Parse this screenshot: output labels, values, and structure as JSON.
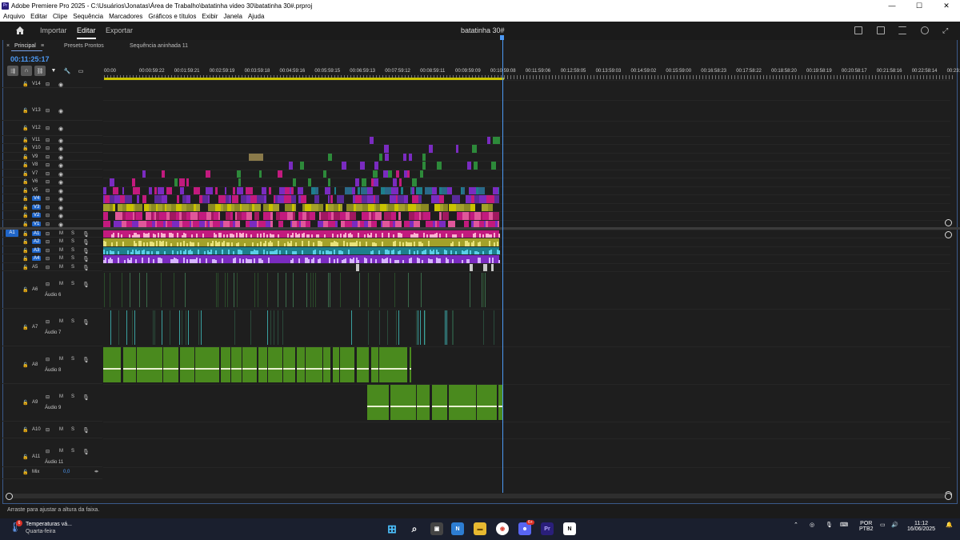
{
  "window": {
    "title": "Adobe Premiere Pro 2025 - C:\\Usuários\\Jonatas\\Área de Trabalho\\batatinha video 30\\batatinha 30#.prproj",
    "app_badge": "Pr",
    "minimize": "—",
    "maximize": "☐",
    "close": "✕"
  },
  "menu": [
    "Arquivo",
    "Editar",
    "Clipe",
    "Sequência",
    "Marcadores",
    "Gráficos e títulos",
    "Exibir",
    "Janela",
    "Ajuda"
  ],
  "nav": {
    "tabs": [
      "Importar",
      "Editar",
      "Exportar"
    ],
    "active": "Editar",
    "project_title": "batatinha 30#"
  },
  "panel": {
    "tabs": [
      "Principal",
      "Presets Prontos",
      "Sequência aninhada 11"
    ],
    "active": "Principal",
    "close": "×",
    "menu_icon": "≡",
    "timecode": "00:11:25:17"
  },
  "ruler": [
    "00:00",
    "00:00:59:22",
    "00:01:59:21",
    "00:02:59:19",
    "00:03:59:18",
    "00:04:59:16",
    "00:05:59:15",
    "00:06:59:13",
    "00:07:59:12",
    "00:08:59:11",
    "00:09:59:09",
    "00:10:59:08",
    "00:11:59:06",
    "00:12:59:05",
    "00:13:59:03",
    "00:14:59:02",
    "00:15:59:00",
    "00:16:58:23",
    "00:17:58:22",
    "00:18:58:20",
    "00:19:58:19",
    "00:20:58:17",
    "00:21:58:16",
    "00:22:58:14",
    "00:23:5"
  ],
  "video_tracks": [
    {
      "name": "V14",
      "tall": false
    },
    {
      "name": "V13",
      "tall": true
    },
    {
      "name": "V12",
      "tall": true
    },
    {
      "name": "V11"
    },
    {
      "name": "V10"
    },
    {
      "name": "V9"
    },
    {
      "name": "V8"
    },
    {
      "name": "V7"
    },
    {
      "name": "V6"
    },
    {
      "name": "V5"
    },
    {
      "name": "V4",
      "on": true
    },
    {
      "name": "V3",
      "on": true
    },
    {
      "name": "V2",
      "on": true
    },
    {
      "name": "V1",
      "on": true
    }
  ],
  "audio_tracks": [
    {
      "name": "A1",
      "on": true,
      "source": "A1"
    },
    {
      "name": "A2",
      "on": true
    },
    {
      "name": "A3",
      "on": true
    },
    {
      "name": "A4",
      "on": true
    },
    {
      "name": "A5"
    },
    {
      "name": "A6",
      "label": "Áudio 6"
    },
    {
      "name": "A7",
      "label": "Áudio 7"
    },
    {
      "name": "A8",
      "label": "Áudio 8"
    },
    {
      "name": "A9",
      "label": "Áudio 9"
    },
    {
      "name": "A10"
    },
    {
      "name": "A11",
      "label": "Áudio 11"
    }
  ],
  "mix": {
    "label": "Mix",
    "value": "0,0"
  },
  "mute_label": "M",
  "solo_label": "S",
  "status": "Arraste para ajustar a altura da faixa.",
  "taskbar": {
    "weather_title": "Temperaturas vá...",
    "weather_day": "Quarta-feira",
    "weather_badge": "6",
    "lang1": "POR",
    "lang2": "PTB2",
    "time": "11:12",
    "date": "16/06/2025",
    "discord_badge": "6+"
  },
  "colors": {
    "accent": "#4d9af5",
    "pink": "#e0579a",
    "magenta": "#c21a7e",
    "olive": "#a3a12a",
    "teal": "#1d7f8c",
    "purple": "#7a2bc0",
    "green": "#4a8a1e",
    "yellow": "#c9c200",
    "light_yellow": "#e8e27a",
    "light_blue": "#5ad0e8",
    "light_pink": "#ffb0d0",
    "lavender": "#d7b5ff"
  }
}
